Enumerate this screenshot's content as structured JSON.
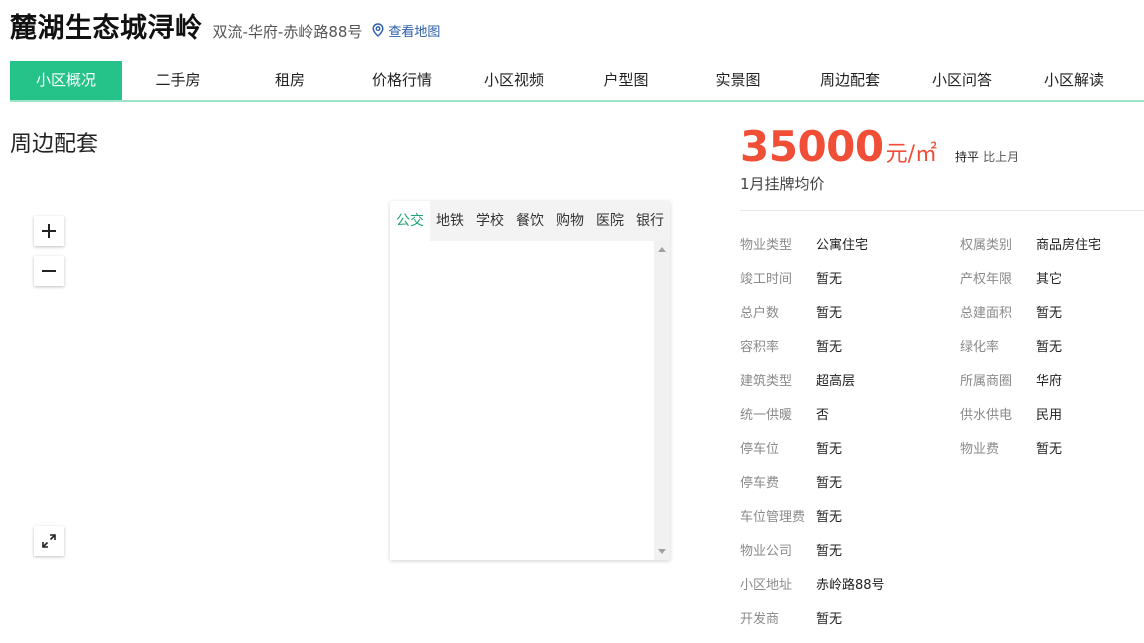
{
  "header": {
    "title": "麓湖生态城浔岭",
    "location": "双流-华府-赤岭路88号",
    "map_link": "查看地图"
  },
  "nav": {
    "items": [
      {
        "label": "小区概况",
        "active": true
      },
      {
        "label": "二手房"
      },
      {
        "label": "租房"
      },
      {
        "label": "价格行情"
      },
      {
        "label": "小区视频"
      },
      {
        "label": "户型图"
      },
      {
        "label": "实景图"
      },
      {
        "label": "周边配套"
      },
      {
        "label": "小区问答"
      },
      {
        "label": "小区解读"
      }
    ]
  },
  "section": {
    "title": "周边配套"
  },
  "map": {
    "controls": {
      "zoom_in": "plus-icon",
      "zoom_out": "minus-icon",
      "fullscreen": "expand-icon"
    },
    "poi_tabs": [
      {
        "label": "公交",
        "active": true
      },
      {
        "label": "地铁"
      },
      {
        "label": "学校"
      },
      {
        "label": "餐饮"
      },
      {
        "label": "购物"
      },
      {
        "label": "医院"
      },
      {
        "label": "银行"
      }
    ]
  },
  "price": {
    "value": "35000",
    "unit": "元/㎡",
    "trend": "持平",
    "compare": "比上月",
    "label": "1月挂牌均价",
    "color": "#f04e37"
  },
  "info": {
    "left": [
      {
        "label": "物业类型",
        "value": "公寓住宅"
      },
      {
        "label": "竣工时间",
        "value": "暂无"
      },
      {
        "label": "总户数",
        "value": "暂无"
      },
      {
        "label": "容积率",
        "value": "暂无"
      },
      {
        "label": "建筑类型",
        "value": "超高层"
      },
      {
        "label": "统一供暖",
        "value": "否"
      },
      {
        "label": "停车位",
        "value": "暂无"
      },
      {
        "label": "停车费",
        "value": "暂无"
      },
      {
        "label": "车位管理费",
        "value": "暂无"
      },
      {
        "label": "物业公司",
        "value": "暂无"
      },
      {
        "label": "小区地址",
        "value": "赤岭路88号"
      },
      {
        "label": "开发商",
        "value": "暂无"
      }
    ],
    "right": [
      {
        "label": "权属类别",
        "value": "商品房住宅"
      },
      {
        "label": "产权年限",
        "value": "其它"
      },
      {
        "label": "总建面积",
        "value": "暂无"
      },
      {
        "label": "绿化率",
        "value": "暂无"
      },
      {
        "label": "所属商圈",
        "value": "华府"
      },
      {
        "label": "供水供电",
        "value": "民用"
      },
      {
        "label": "物业费",
        "value": "暂无"
      }
    ]
  },
  "colors": {
    "accent": "#25c38a",
    "price": "#f04e37",
    "link": "#2a5caa"
  }
}
